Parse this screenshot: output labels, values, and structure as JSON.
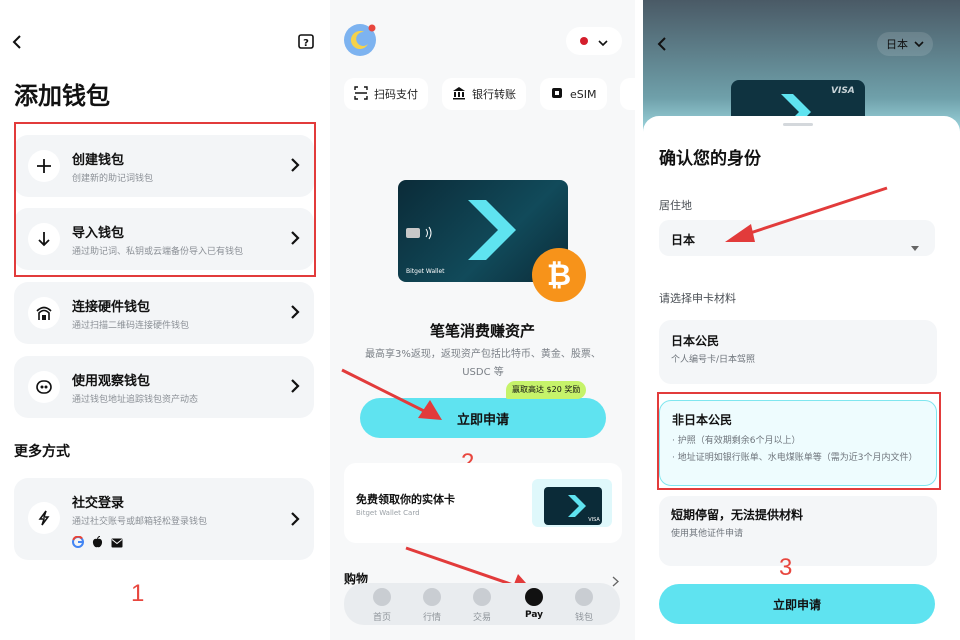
{
  "panel1": {
    "title": "添加钱包",
    "cards": [
      {
        "title": "创建钱包",
        "subtitle": "创建新的助记词钱包"
      },
      {
        "title": "导入钱包",
        "subtitle": "通过助记词、私钥或云端备份导入已有钱包"
      },
      {
        "title": "连接硬件钱包",
        "subtitle": "通过扫描二维码连接硬件钱包"
      },
      {
        "title": "使用观察钱包",
        "subtitle": "通过钱包地址追踪钱包资产动态"
      }
    ],
    "more_section": "更多方式",
    "social": {
      "title": "社交登录",
      "subtitle": "通过社交账号或邮箱轻松登录钱包"
    },
    "annotation": "1"
  },
  "panel2": {
    "chips": [
      "扫码支付",
      "银行转账",
      "eSIM"
    ],
    "card_brand": "Bitget Wallet",
    "headline": "笔笔消费赚资产",
    "description": "最高享3%返现，返现资产包括比特币、黄金、股票、USDC 等",
    "reward_badge": "赢取高达 $20 奖励",
    "apply_button": "立即申请",
    "annotation": "2",
    "physical_card": {
      "title": "免费领取你的实体卡",
      "subtitle": "Bitget Wallet Card"
    },
    "shopping": "购物",
    "nav": [
      {
        "label": "首页"
      },
      {
        "label": "行情"
      },
      {
        "label": "交易"
      },
      {
        "label": "Pay"
      },
      {
        "label": "钱包"
      }
    ]
  },
  "panel3": {
    "country_selector": "日本",
    "card_brand": "VISA",
    "title": "确认您的身份",
    "residence_label": "居住地",
    "residence_value": "日本",
    "materials_label": "请选择申卡材料",
    "options": [
      {
        "title": "日本公民",
        "lines": [
          "个人编号卡/日本驾照"
        ]
      },
      {
        "title": "非日本公民",
        "lines": [
          "· 护照（有效期剩余6个月以上）",
          "· 地址证明如银行账单、水电煤账单等（需为近3个月内文件）"
        ]
      },
      {
        "title": "短期停留，无法提供材料",
        "lines": [
          "使用其他证件申请"
        ]
      }
    ],
    "apply_button": "立即申请",
    "annotation": "3"
  },
  "colors": {
    "accent_cyan": "#5fe3f0",
    "annotation_red": "#e23b3b",
    "bitcoin_orange": "#f7931a"
  }
}
